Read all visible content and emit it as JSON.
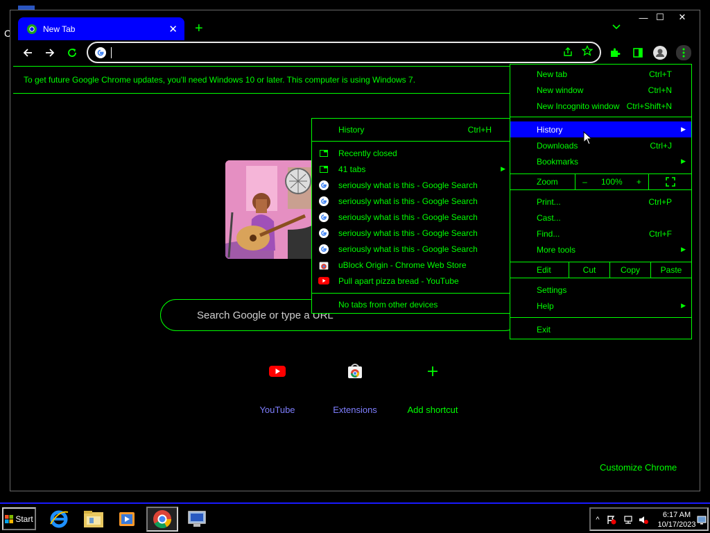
{
  "desktop": {
    "partial_char": "C"
  },
  "window": {
    "controls": {
      "minimize": "—",
      "maximize": "☐",
      "close": "✕"
    },
    "tab": {
      "title": "New Tab",
      "close": "✕"
    },
    "new_tab_symbol": "+",
    "tab_search_symbol": "⌄"
  },
  "toolbar": {
    "back": "←",
    "forward": "→",
    "reload": "↻",
    "omnibox_value": "",
    "icons": [
      "share-icon",
      "star-icon",
      "extensions-puzzle-icon",
      "side-panel-icon",
      "profile-icon",
      "kebab-menu-icon"
    ]
  },
  "infobar": {
    "text": "To get future Google Chrome updates, you'll need Windows 10 or later. This computer is using Windows 7."
  },
  "ntp": {
    "search_placeholder": "Search Google or type a URL",
    "shortcuts": [
      {
        "label": "YouTube"
      },
      {
        "label": "Extensions"
      },
      {
        "label": "Add shortcut"
      }
    ],
    "customize_label": "Customize Chrome"
  },
  "chrome_menu": {
    "items_top": [
      {
        "label": "New tab",
        "shortcut": "Ctrl+T"
      },
      {
        "label": "New window",
        "shortcut": "Ctrl+N"
      },
      {
        "label": "New Incognito window",
        "shortcut": "Ctrl+Shift+N"
      }
    ],
    "items_mid": [
      {
        "label": "History",
        "shortcut": "",
        "arrow": "▶"
      },
      {
        "label": "Downloads",
        "shortcut": "Ctrl+J"
      },
      {
        "label": "Bookmarks",
        "shortcut": "",
        "arrow": "▶"
      }
    ],
    "zoom": {
      "label": "Zoom",
      "minus": "–",
      "value": "100%",
      "plus": "+",
      "fullscreen": "⛶"
    },
    "items_tools": [
      {
        "label": "Print...",
        "shortcut": "Ctrl+P"
      },
      {
        "label": "Cast...",
        "shortcut": ""
      },
      {
        "label": "Find...",
        "shortcut": "Ctrl+F"
      },
      {
        "label": "More tools",
        "shortcut": "",
        "arrow": "▶"
      }
    ],
    "edit": {
      "label": "Edit",
      "cut": "Cut",
      "copy": "Copy",
      "paste": "Paste"
    },
    "items_bottom": [
      {
        "label": "Settings",
        "arrow": ""
      },
      {
        "label": "Help",
        "arrow": "▶"
      }
    ],
    "exit": "Exit"
  },
  "history_menu": {
    "header": {
      "label": "History",
      "shortcut": "Ctrl+H"
    },
    "recently_closed": "Recently closed",
    "tabs_group": {
      "label": "41 tabs",
      "arrow": "▶"
    },
    "entries": [
      "seriously what is this - Google Search",
      "seriously what is this - Google Search",
      "seriously what is this - Google Search",
      "seriously what is this - Google Search",
      "seriously what is this - Google Search",
      "uBlock Origin - Chrome Web Store",
      "Pull apart pizza bread - YouTube"
    ],
    "footer": "No tabs from other devices"
  },
  "taskbar": {
    "start_label": "Start",
    "clock_time": "6:17 AM",
    "clock_date": "10/17/2023",
    "tray_expand": "^"
  },
  "colors": {
    "accent": "#00ff00",
    "highlight": "#0000ff",
    "link": "#7f7fff"
  }
}
